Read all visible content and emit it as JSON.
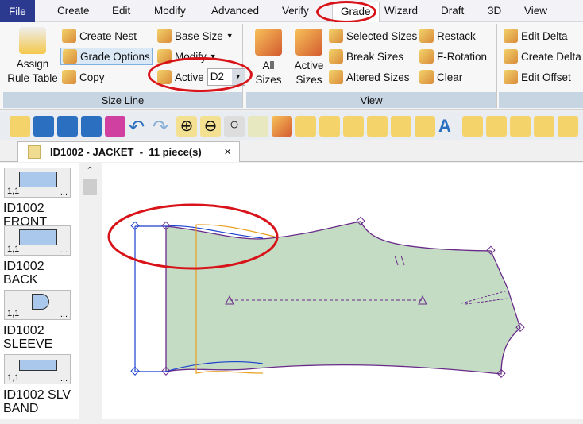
{
  "menu": {
    "file": "File",
    "items": [
      "Create",
      "Edit",
      "Modify",
      "Advanced",
      "Verify",
      "Grade",
      "Wizard",
      "Draft",
      "3D",
      "View"
    ],
    "active": "Grade"
  },
  "ribbon": {
    "size_line": {
      "label": "Size Line",
      "assign": "Assign Rule Table",
      "create_nest": "Create Nest",
      "grade_options": "Grade Options",
      "copy": "Copy",
      "base_size": "Base Size",
      "modify": "Modify",
      "active_label": "Active",
      "active_value": "D2"
    },
    "view": {
      "label": "View",
      "all_sizes": "All Sizes",
      "active_sizes": "Active Sizes",
      "selected_sizes": "Selected Sizes",
      "break_sizes": "Break Sizes",
      "altered_sizes": "Altered Sizes",
      "restack": "Restack",
      "f_rotation": "F-Rotation",
      "clear": "Clear"
    },
    "delta": {
      "edit_delta": "Edit Delta",
      "create_delta": "Create Delta",
      "edit_offset": "Edit Offset"
    }
  },
  "tab": {
    "title": "ID1002 - JACKET  -  11 piece(s)",
    "close": "×"
  },
  "pieces": [
    {
      "name": "",
      "qty": "1,1",
      "more": "..."
    },
    {
      "name": "ID1002 FRONT",
      "qty": "1,1",
      "more": "..."
    },
    {
      "name": "ID1002 BACK",
      "qty": "1,1",
      "more": "..."
    },
    {
      "name": "ID1002 SLEEVE",
      "qty": "1,1",
      "more": "..."
    },
    {
      "name": "ID1002 SLV BAND",
      "qty": "",
      "more": ""
    }
  ],
  "colors": {
    "piece_fill": "#c3dcc3",
    "outline": "#6a2a8a",
    "grade_blue": "#1a3fd0",
    "grade_orange": "#e8a020",
    "highlight": "#d8141a"
  }
}
